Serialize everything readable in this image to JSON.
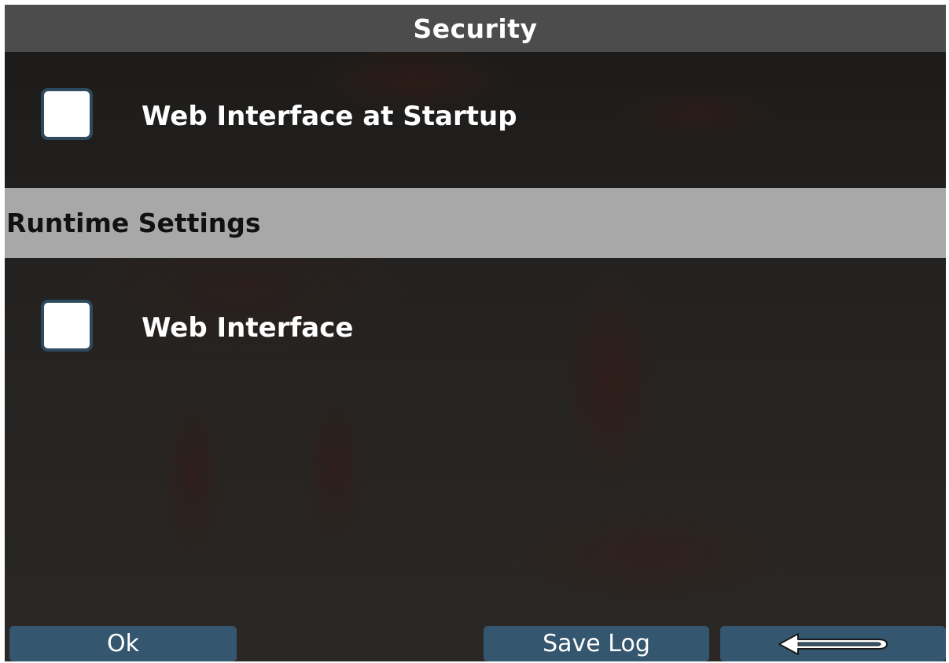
{
  "window": {
    "title": "Security"
  },
  "options": [
    {
      "label": "Web Interface at Startup",
      "checked": false
    },
    {
      "label": "Web Interface",
      "checked": false
    }
  ],
  "section": {
    "title": "Runtime Settings"
  },
  "footer": {
    "ok_label": "Ok",
    "save_log_label": "Save Log",
    "back_icon": "left-arrow-icon"
  },
  "colors": {
    "titlebar_bg": "#4c4c4c",
    "section_bg": "#a8a8a8",
    "button_bg": "#34566e",
    "checkbox_border": "#2e4a5e"
  }
}
